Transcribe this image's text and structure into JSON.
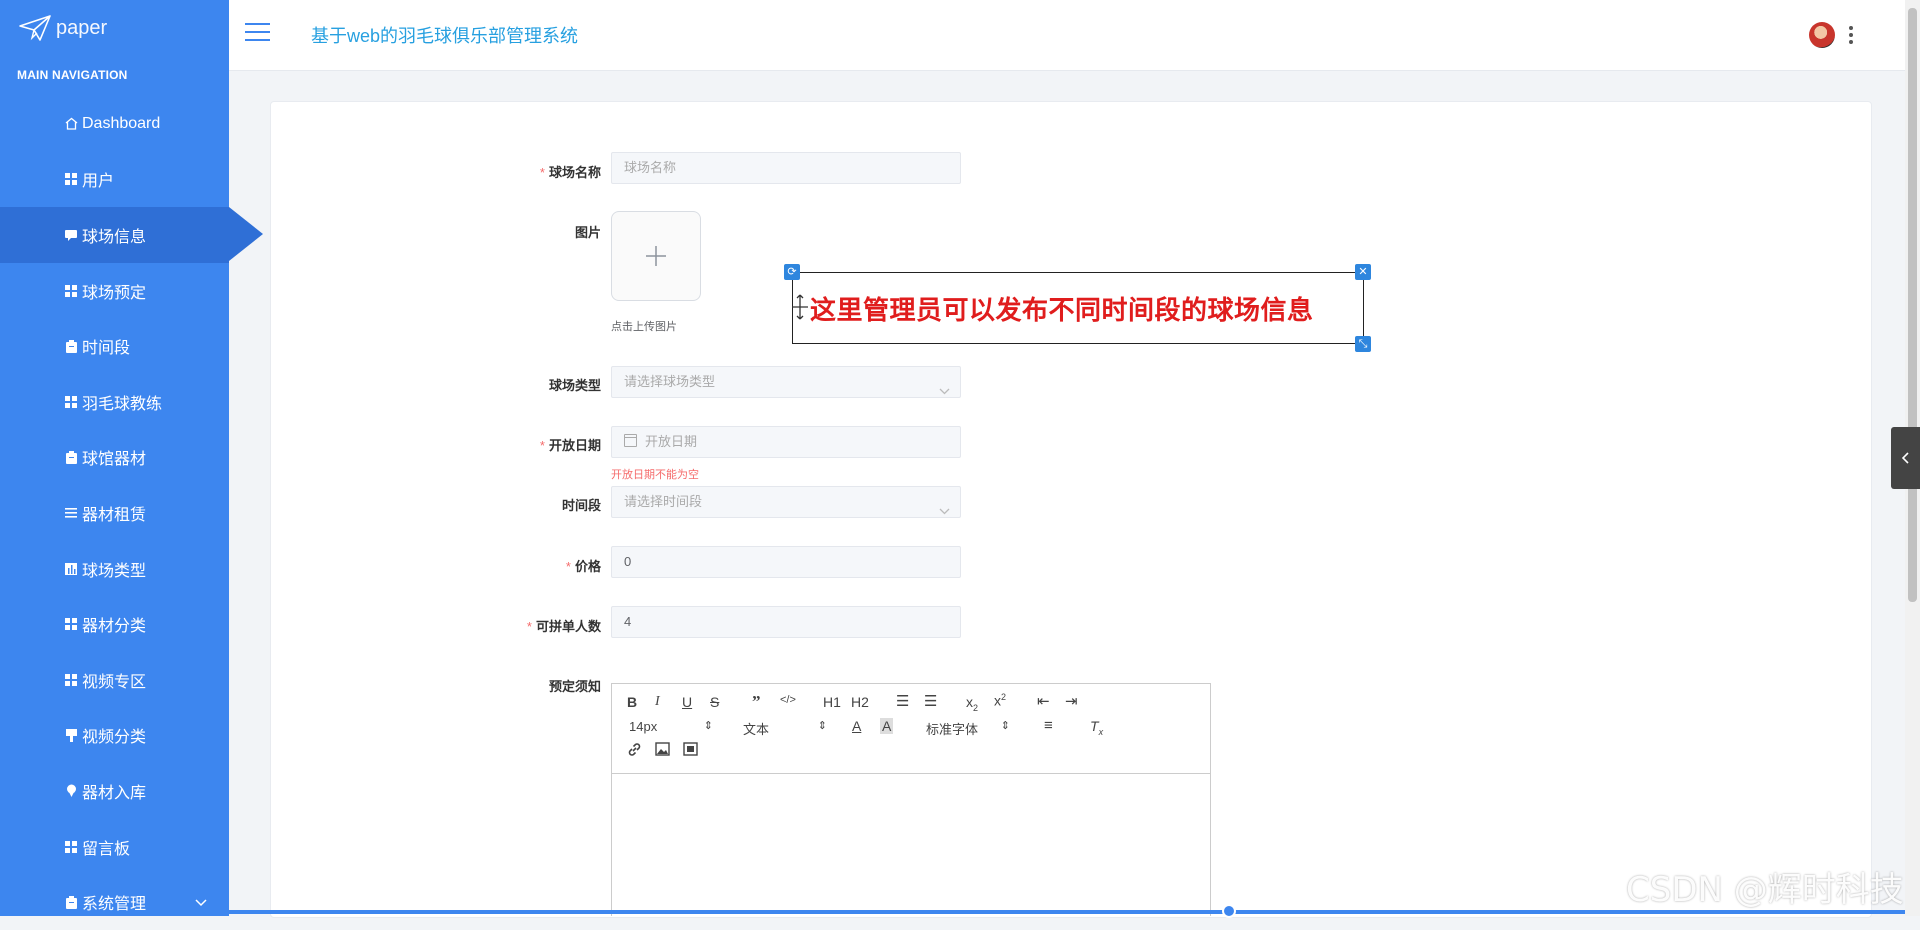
{
  "brand": {
    "name": "paper",
    "icon": "paper-plane-icon"
  },
  "sidebar": {
    "heading": "MAIN NAVIGATION",
    "items": [
      {
        "label": "Dashboard",
        "icon": "home-icon"
      },
      {
        "label": "用户",
        "icon": "grid-icon"
      },
      {
        "label": "球场信息",
        "icon": "comment-icon",
        "active": true
      },
      {
        "label": "球场预定",
        "icon": "grid-icon"
      },
      {
        "label": "时间段",
        "icon": "clipboard-icon"
      },
      {
        "label": "羽毛球教练",
        "icon": "grid-icon"
      },
      {
        "label": "球馆器材",
        "icon": "clipboard-icon"
      },
      {
        "label": "器材租赁",
        "icon": "list-icon"
      },
      {
        "label": "球场类型",
        "icon": "bar-icon"
      },
      {
        "label": "器材分类",
        "icon": "grid-icon"
      },
      {
        "label": "视频专区",
        "icon": "grid-icon"
      },
      {
        "label": "视频分类",
        "icon": "bookmark-icon"
      },
      {
        "label": "器材入库",
        "icon": "pin-icon"
      },
      {
        "label": "留言板",
        "icon": "grid-icon"
      },
      {
        "label": "系统管理",
        "icon": "clipboard-icon",
        "expandable": true
      }
    ]
  },
  "header": {
    "title": "基于web的羽毛球俱乐部管理系统"
  },
  "form": {
    "name_label": "球场名称",
    "name_placeholder": "球场名称",
    "image_label": "图片",
    "upload_hint": "点击上传图片",
    "type_label": "球场类型",
    "type_placeholder": "请选择球场类型",
    "date_label": "开放日期",
    "date_placeholder": "开放日期",
    "date_error": "开放日期不能为空",
    "timeslot_label": "时间段",
    "timeslot_placeholder": "请选择时间段",
    "price_label": "价格",
    "price_value": "0",
    "group_label": "可拼单人数",
    "group_value": "4",
    "notes_label": "预定须知"
  },
  "editor": {
    "font_size": "14px",
    "text_style": "文本",
    "font_family": "标准字体",
    "heading1": "H1",
    "heading2": "H2"
  },
  "annotation": {
    "text": "这里管理员可以发布不同时间段的球场信息"
  },
  "watermark": "CSDN @辉时科技",
  "colors": {
    "sidebar": "#3d86ef",
    "active": "#2f6fd6",
    "title": "#27a0e0",
    "required": "#f56c6c",
    "annotation": "#e01d1d"
  }
}
